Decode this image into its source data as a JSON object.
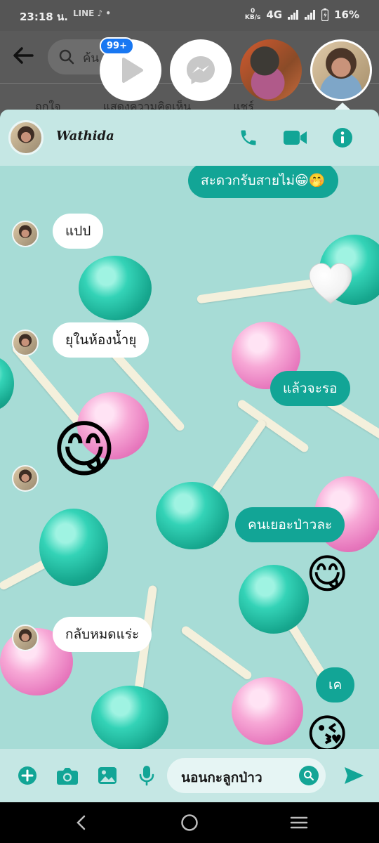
{
  "status_bar": {
    "time": "23:18 น.",
    "app_icons": "LINE ♪ •",
    "net_speed_value": "0",
    "net_speed_unit": "KB/s",
    "network": "4G",
    "battery": "16%"
  },
  "background_header": {
    "search_placeholder": "ค้น",
    "actions": [
      "ถูกใจ",
      "แสดงความคิดเห็น",
      "แชร์"
    ]
  },
  "chat_heads": {
    "badge": "99+",
    "items": [
      "video-app",
      "messenger",
      "contact-photo",
      "wathida-photo"
    ]
  },
  "chat": {
    "contact_name": "Wathida",
    "messages": [
      {
        "side": "out",
        "type": "text",
        "text": "สะดวกรับสายไม่😁🤭"
      },
      {
        "side": "in",
        "type": "text",
        "text": "แปป"
      },
      {
        "side": "out",
        "type": "sticker",
        "text": "🤍"
      },
      {
        "side": "in",
        "type": "text",
        "text": "ยุในห้องน้ำยุ"
      },
      {
        "side": "out",
        "type": "text",
        "text": "แล้วจะรอ"
      },
      {
        "side": "in",
        "type": "emoji",
        "text": "😋"
      },
      {
        "side": "out",
        "type": "text",
        "text": "คนเยอะป่าวละ"
      },
      {
        "side": "out",
        "type": "emoji",
        "text": "😋"
      },
      {
        "side": "in",
        "type": "text",
        "text": "กลับหมดแร่ะ"
      },
      {
        "side": "out",
        "type": "text",
        "text": "เค"
      },
      {
        "side": "out",
        "type": "emoji",
        "text": "😘"
      }
    ]
  },
  "composer": {
    "input_value": "นอนกะลูกป่าว"
  },
  "colors": {
    "accent": "#12a596",
    "chat_bg": "#a7dcd6",
    "header_bg": "#c5e7e4"
  },
  "icons": [
    "back-arrow-icon",
    "search-icon",
    "play-icon",
    "messenger-icon",
    "phone-icon",
    "video-camera-icon",
    "info-icon",
    "plus-icon",
    "camera-icon",
    "image-icon",
    "microphone-icon",
    "emoji-icon",
    "send-icon"
  ]
}
